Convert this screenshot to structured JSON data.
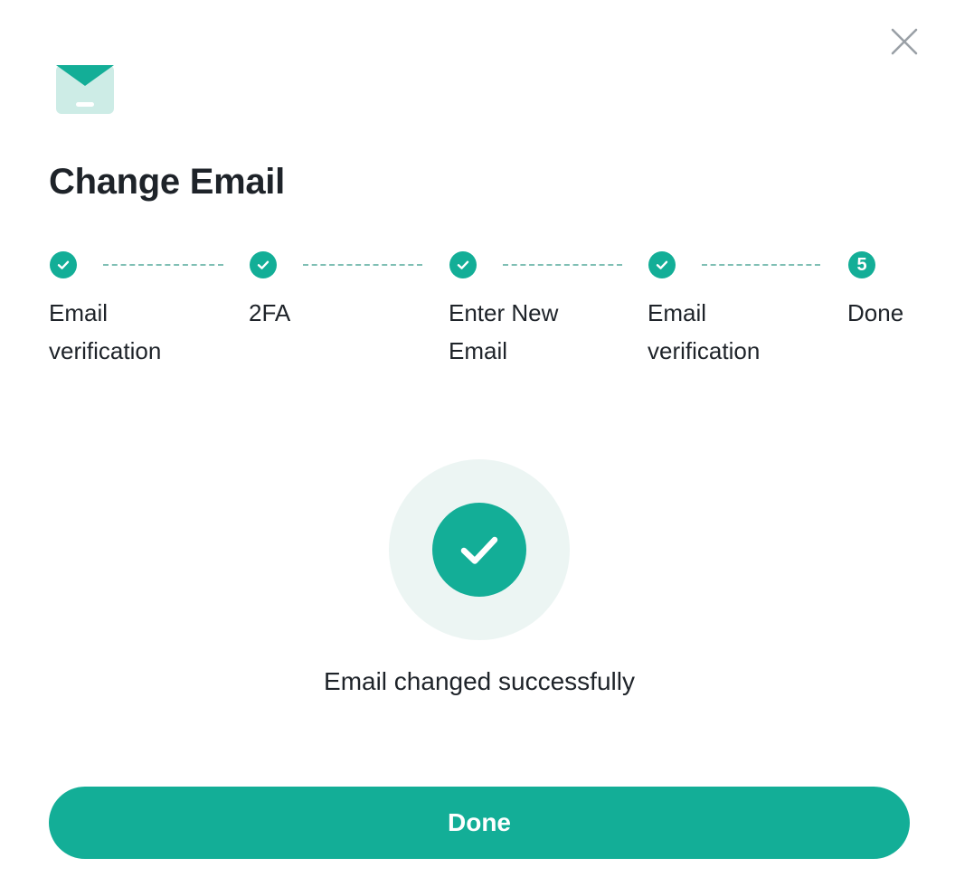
{
  "dialog": {
    "title": "Change Email",
    "close_icon": "close-icon",
    "header_icon": "envelope-icon"
  },
  "steps": [
    {
      "label": "Email\nverification",
      "status": "completed",
      "icon": "check-icon"
    },
    {
      "label": "2FA",
      "status": "completed",
      "icon": "check-icon"
    },
    {
      "label": "Enter New\nEmail",
      "status": "completed",
      "icon": "check-icon"
    },
    {
      "label": "Email\nverification",
      "status": "completed",
      "icon": "check-icon"
    },
    {
      "label": "Done",
      "status": "current",
      "number": "5"
    }
  ],
  "result": {
    "icon": "success-check-icon",
    "message": "Email changed successfully"
  },
  "actions": {
    "done_label": "Done"
  },
  "colors": {
    "accent": "#13ae97",
    "accent_light": "#ecf5f3",
    "icon_light": "#cdece6",
    "text": "#1e2329",
    "close": "#9aa0a6",
    "connector": "#7fbfb4"
  }
}
